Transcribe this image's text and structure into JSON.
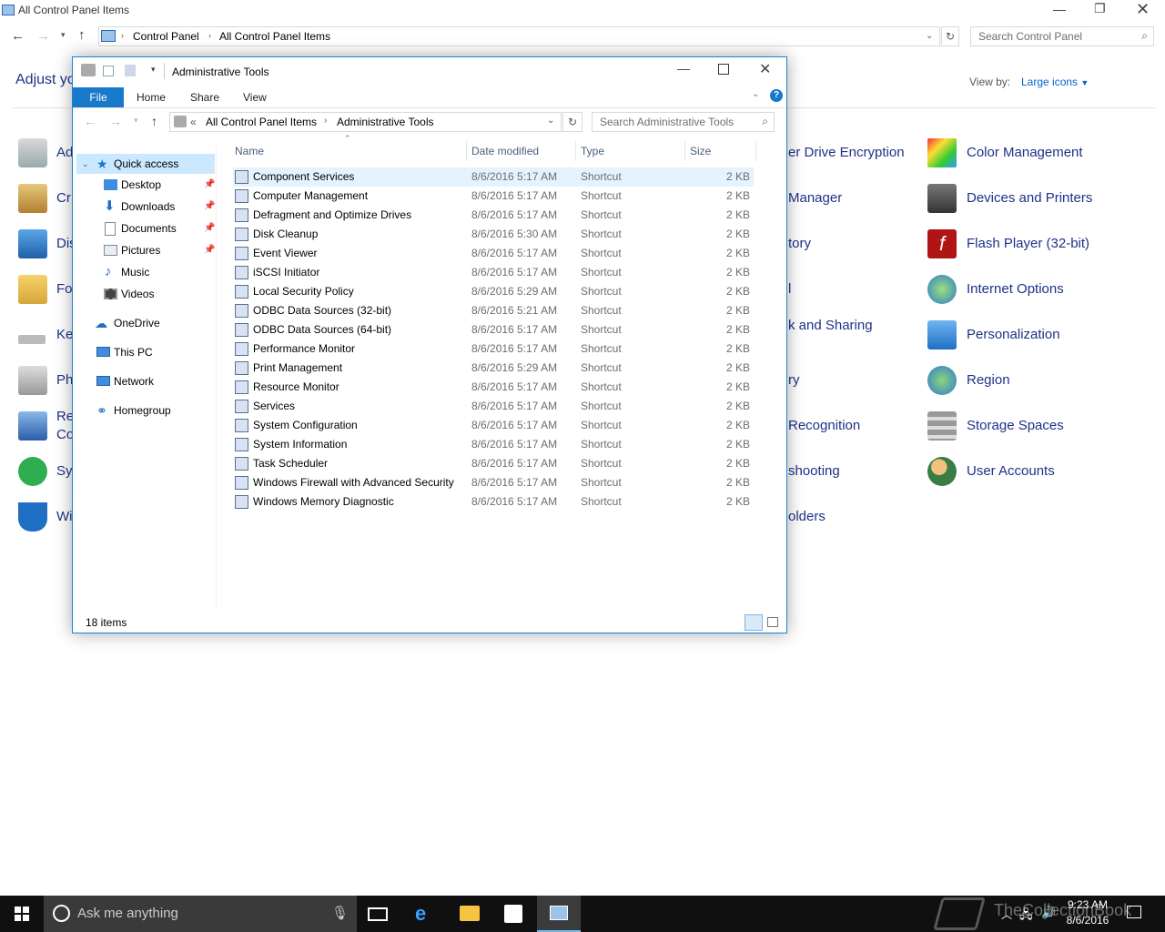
{
  "bg_window": {
    "title": "All Control Panel Items",
    "breadcrumb": [
      "Control Panel",
      "All Control Panel Items"
    ],
    "search_placeholder": "Search Control Panel",
    "heading": "Adjust yo",
    "view_by_label": "View by:",
    "view_by_value": "Large icons",
    "left_items": [
      "Ad",
      "Cr",
      "Dis",
      "Fo",
      "Ke",
      "Ph",
      "Re",
      "Co",
      "Sy",
      "Wi"
    ],
    "mid_items": [
      "er Drive Encryption",
      "Manager",
      "tory",
      "l",
      "k and Sharing",
      "ry",
      "Recognition",
      "shooting",
      "olders"
    ],
    "right_items": [
      "Color Management",
      "Devices and Printers",
      "Flash Player (32-bit)",
      "Internet Options",
      "Personalization",
      "Region",
      "Storage Spaces",
      "User Accounts"
    ]
  },
  "explorer": {
    "title": "Administrative Tools",
    "ribbon": {
      "file": "File",
      "home": "Home",
      "share": "Share",
      "view": "View",
      "help": "?"
    },
    "address": {
      "prefix": "«",
      "crumb1": "All Control Panel Items",
      "crumb2": "Administrative Tools"
    },
    "search_placeholder": "Search Administrative Tools",
    "nav": {
      "quick_access": "Quick access",
      "desktop": "Desktop",
      "downloads": "Downloads",
      "documents": "Documents",
      "pictures": "Pictures",
      "music": "Music",
      "videos": "Videos",
      "onedrive": "OneDrive",
      "thispc": "This PC",
      "network": "Network",
      "homegroup": "Homegroup"
    },
    "columns": {
      "name": "Name",
      "date": "Date modified",
      "type": "Type",
      "size": "Size"
    },
    "files": [
      {
        "name": "Component Services",
        "date": "8/6/2016 5:17 AM",
        "type": "Shortcut",
        "size": "2 KB"
      },
      {
        "name": "Computer Management",
        "date": "8/6/2016 5:17 AM",
        "type": "Shortcut",
        "size": "2 KB"
      },
      {
        "name": "Defragment and Optimize Drives",
        "date": "8/6/2016 5:17 AM",
        "type": "Shortcut",
        "size": "2 KB"
      },
      {
        "name": "Disk Cleanup",
        "date": "8/6/2016 5:30 AM",
        "type": "Shortcut",
        "size": "2 KB"
      },
      {
        "name": "Event Viewer",
        "date": "8/6/2016 5:17 AM",
        "type": "Shortcut",
        "size": "2 KB"
      },
      {
        "name": "iSCSI Initiator",
        "date": "8/6/2016 5:17 AM",
        "type": "Shortcut",
        "size": "2 KB"
      },
      {
        "name": "Local Security Policy",
        "date": "8/6/2016 5:29 AM",
        "type": "Shortcut",
        "size": "2 KB"
      },
      {
        "name": "ODBC Data Sources (32-bit)",
        "date": "8/6/2016 5:21 AM",
        "type": "Shortcut",
        "size": "2 KB"
      },
      {
        "name": "ODBC Data Sources (64-bit)",
        "date": "8/6/2016 5:17 AM",
        "type": "Shortcut",
        "size": "2 KB"
      },
      {
        "name": "Performance Monitor",
        "date": "8/6/2016 5:17 AM",
        "type": "Shortcut",
        "size": "2 KB"
      },
      {
        "name": "Print Management",
        "date": "8/6/2016 5:29 AM",
        "type": "Shortcut",
        "size": "2 KB"
      },
      {
        "name": "Resource Monitor",
        "date": "8/6/2016 5:17 AM",
        "type": "Shortcut",
        "size": "2 KB"
      },
      {
        "name": "Services",
        "date": "8/6/2016 5:17 AM",
        "type": "Shortcut",
        "size": "2 KB"
      },
      {
        "name": "System Configuration",
        "date": "8/6/2016 5:17 AM",
        "type": "Shortcut",
        "size": "2 KB"
      },
      {
        "name": "System Information",
        "date": "8/6/2016 5:17 AM",
        "type": "Shortcut",
        "size": "2 KB"
      },
      {
        "name": "Task Scheduler",
        "date": "8/6/2016 5:17 AM",
        "type": "Shortcut",
        "size": "2 KB"
      },
      {
        "name": "Windows Firewall with Advanced Security",
        "date": "8/6/2016 5:17 AM",
        "type": "Shortcut",
        "size": "2 KB"
      },
      {
        "name": "Windows Memory Diagnostic",
        "date": "8/6/2016 5:17 AM",
        "type": "Shortcut",
        "size": "2 KB"
      }
    ],
    "status": "18 items"
  },
  "taskbar": {
    "search_placeholder": "Ask me anything",
    "time": "9:23 AM",
    "date": "8/6/2016",
    "watermark": "TheCollectionBook"
  },
  "colors": {
    "accent": "#1979ca",
    "link": "#1e3287",
    "selection": "#cce8ff"
  }
}
